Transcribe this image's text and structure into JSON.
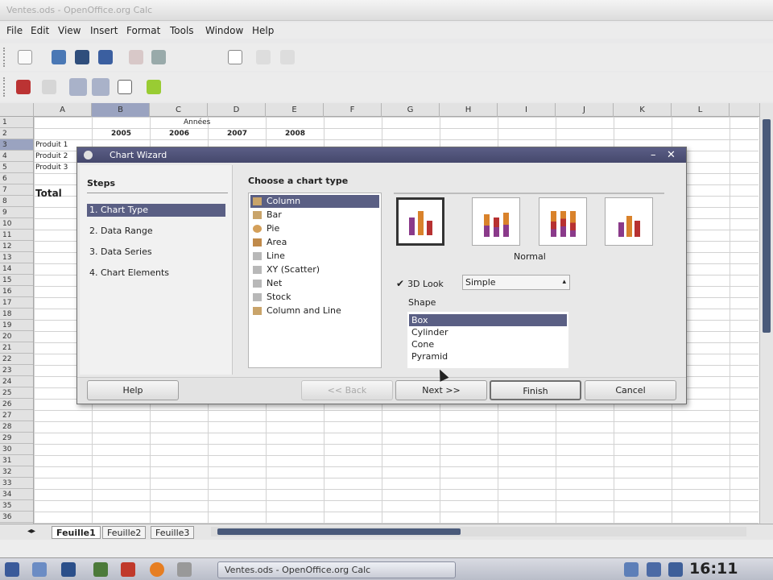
{
  "window": {
    "title": "Ventes.ods - OpenOffice.org Calc"
  },
  "menu": [
    "File",
    "Edit",
    "View",
    "Insert",
    "Format",
    "Tools",
    "Window",
    "Help"
  ],
  "sheet": {
    "columns": [
      "A",
      "B",
      "C",
      "D",
      "E",
      "F",
      "G",
      "H",
      "I",
      "J",
      "K",
      "L"
    ],
    "rows": [
      "1",
      "2",
      "3",
      "4",
      "5",
      "6",
      "7",
      "8",
      "9",
      "10",
      "11",
      "12",
      "13",
      "14",
      "15",
      "16",
      "17",
      "18",
      "19",
      "20",
      "21",
      "22",
      "23",
      "24",
      "25",
      "26",
      "27",
      "28",
      "29",
      "30",
      "31",
      "32",
      "33",
      "34",
      "35",
      "36"
    ],
    "cells": {
      "annees": "Années",
      "y2005": "2005",
      "y2006": "2006",
      "y2007": "2007",
      "y2008": "2008",
      "p1": "Produit 1",
      "p2": "Produit 2",
      "p3": "Produit 3",
      "total": "Total"
    },
    "tabs": [
      "Feuille1",
      "Feuille2",
      "Feuille3"
    ]
  },
  "dialog": {
    "title": "Chart Wizard",
    "steps_heading": "Steps",
    "steps": [
      "1. Chart Type",
      "2. Data Range",
      "3. Data Series",
      "4. Chart Elements"
    ],
    "content_title": "Choose a chart type",
    "chart_types": [
      "Column",
      "Bar",
      "Pie",
      "Area",
      "Line",
      "XY (Scatter)",
      "Net",
      "Stock",
      "Column and Line"
    ],
    "variant_caption": "Normal",
    "look_3d_label": "3D Look",
    "look_3d_checked": true,
    "look_combo_value": "Simple",
    "shape_label": "Shape",
    "shapes": [
      "Box",
      "Cylinder",
      "Cone",
      "Pyramid"
    ],
    "buttons": {
      "help": "Help",
      "back": "<< Back",
      "next": "Next >>",
      "finish": "Finish",
      "cancel": "Cancel"
    }
  },
  "taskbar": {
    "task_label": "Ventes.ods - OpenOffice.org Calc",
    "clock": "16:11"
  }
}
